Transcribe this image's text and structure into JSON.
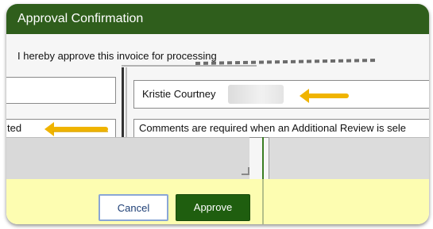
{
  "window": {
    "title": "Approval Confirmation"
  },
  "form": {
    "statement": "I hereby approve this invoice for processing",
    "approver_name": "Kristie Courtney",
    "comments_hint": "Comments are required when an Additional Review is sele",
    "left_truncated_text": "ted"
  },
  "actions": {
    "cancel_label": "Cancel",
    "approve_label": "Approve"
  },
  "colors": {
    "title_bar": "#2f5e1c",
    "approve_button": "#1f5e0f",
    "footer": "#fdfdb1",
    "callout_arrow": "#f0b400"
  },
  "icons": {
    "annotation": "arrow-left-icon"
  }
}
